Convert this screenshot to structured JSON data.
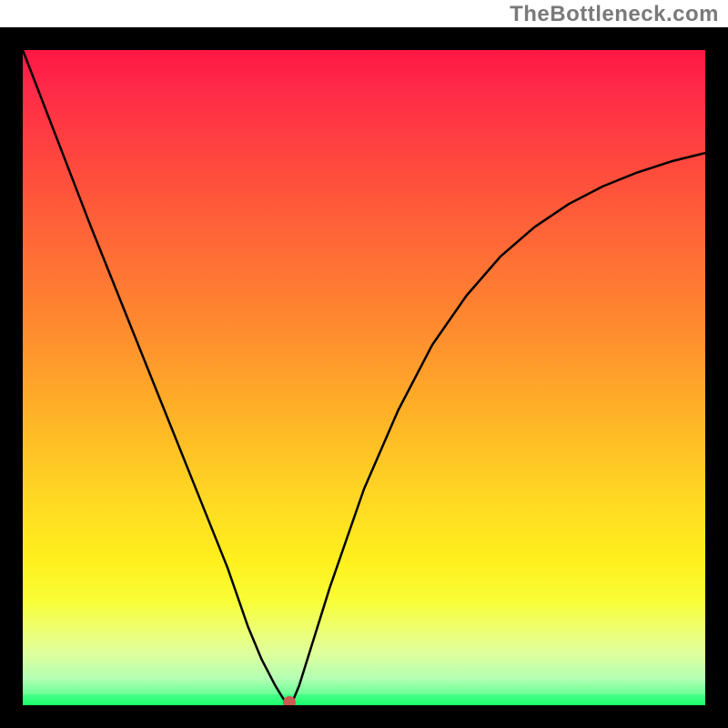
{
  "watermark": "TheBottleneck.com",
  "chart_data": {
    "type": "line",
    "title": "",
    "xlabel": "",
    "ylabel": "",
    "xlim": [
      0,
      100
    ],
    "ylim": [
      0,
      100
    ],
    "grid": false,
    "legend": false,
    "series": [
      {
        "name": "curve",
        "x": [
          0,
          5,
          10,
          15,
          20,
          25,
          30,
          33,
          35,
          37,
          38,
          38.5,
          39.5,
          40.5,
          45,
          50,
          55,
          60,
          65,
          70,
          75,
          80,
          85,
          90,
          95,
          100
        ],
        "y": [
          100,
          86.5,
          73,
          60,
          47,
          34,
          21,
          12,
          7,
          3,
          1.3,
          0.5,
          0.5,
          3,
          18,
          33,
          45,
          55,
          62.5,
          68.5,
          73,
          76.5,
          79.2,
          81.3,
          83,
          84.3
        ]
      }
    ],
    "marker": {
      "x": 39,
      "y": 0.4
    },
    "background_gradient": {
      "top": "#ff1744",
      "mid": "#ffd723",
      "bottom": "#34ff7e"
    }
  },
  "colors": {
    "border": "#000000",
    "curve": "#000000",
    "marker": "#cc5a52",
    "watermark": "#7a7a7a"
  }
}
